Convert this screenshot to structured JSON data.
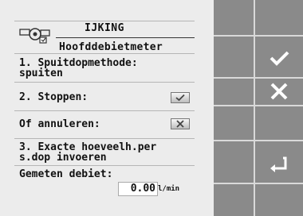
{
  "header": {
    "title": "IJKING",
    "subtitle": "Hoofddebietmeter"
  },
  "steps": [
    {
      "line1": "1. Spuitdopmethode:",
      "line2": "spuiten"
    },
    {
      "line1": "2. Stoppen:"
    },
    {
      "line1": "Of annuleren:"
    },
    {
      "line1": "3. Exacte hoeveelh.per",
      "line2": "s.dop invoeren"
    }
  ],
  "measured": {
    "label": "Gemeten debiet:",
    "value": "0.00",
    "unit": "l/min"
  },
  "icons": {
    "header": "flowmeter-icon",
    "confirm": "checkmark-icon",
    "cancel": "cross-icon",
    "back": "return-arrow-icon"
  }
}
